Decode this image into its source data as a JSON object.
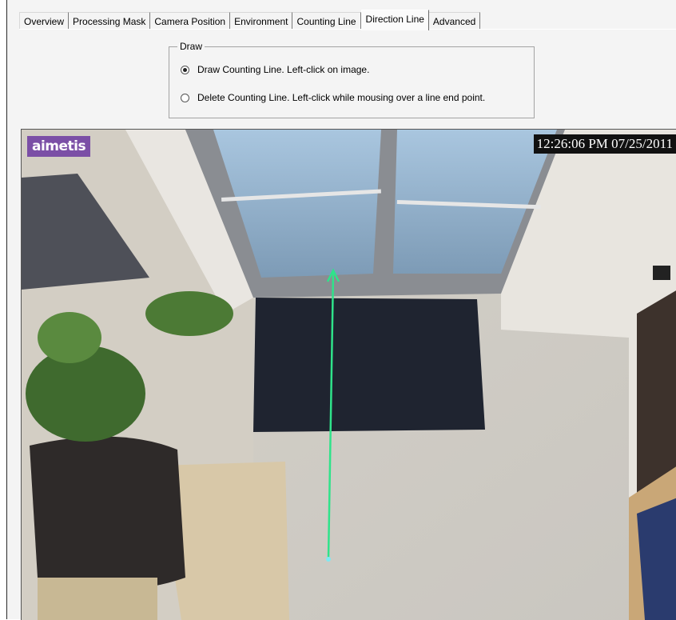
{
  "tabs": [
    {
      "label": "Overview",
      "active": false
    },
    {
      "label": "Processing Mask",
      "active": false
    },
    {
      "label": "Camera Position",
      "active": false
    },
    {
      "label": "Environment",
      "active": false
    },
    {
      "label": "Counting Line",
      "active": false
    },
    {
      "label": "Direction Line",
      "active": true
    },
    {
      "label": "Advanced",
      "active": false
    }
  ],
  "draw_group": {
    "legend": "Draw",
    "options": [
      {
        "label": "Draw Counting Line.  Left-click on image.",
        "checked": true
      },
      {
        "label": "Delete Counting Line. Left-click while mousing over a line end point.",
        "checked": false
      }
    ]
  },
  "video": {
    "logo_text": "aimetis",
    "timestamp": "12:26:06 PM 07/25/2011",
    "direction_line_color": "#2fe38a"
  },
  "colors": {
    "logo_bg": "#7b4fa6",
    "panel_bg": "#f4f4f4",
    "floor": "#d9d5cc",
    "carpet": "#1f2430"
  }
}
